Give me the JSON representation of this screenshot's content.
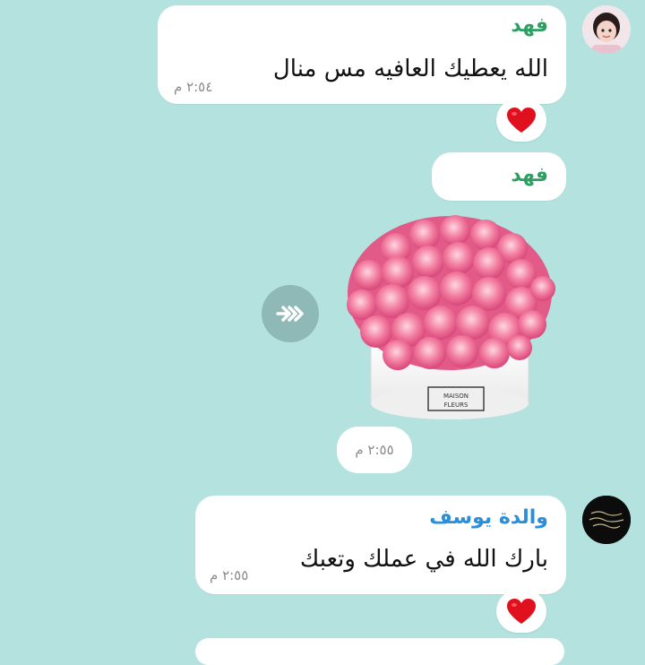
{
  "messages": [
    {
      "sender": "فهد",
      "text": "الله يعطيك العافيه مس منال",
      "time": "٢:٥٤ م",
      "reaction": "heart"
    },
    {
      "sender": "فهد",
      "image": "pink-roses-box",
      "image_caption_text": "MAISON FLEURS",
      "time": "٢:٥٥ م"
    },
    {
      "sender": "والدة يوسف",
      "text": "بارك الله في عملك وتعبك",
      "time": "٢:٥٥ م",
      "reaction": "heart"
    }
  ],
  "colors": {
    "background": "#b4e3df",
    "sender_green": "#2e9e62",
    "sender_blue": "#2a8fd8",
    "heart": "#e0101e",
    "forward_button": "#8fb9b6"
  },
  "icons": {
    "forward": "double-chevron-forward-icon",
    "reaction": "red-heart-icon"
  }
}
